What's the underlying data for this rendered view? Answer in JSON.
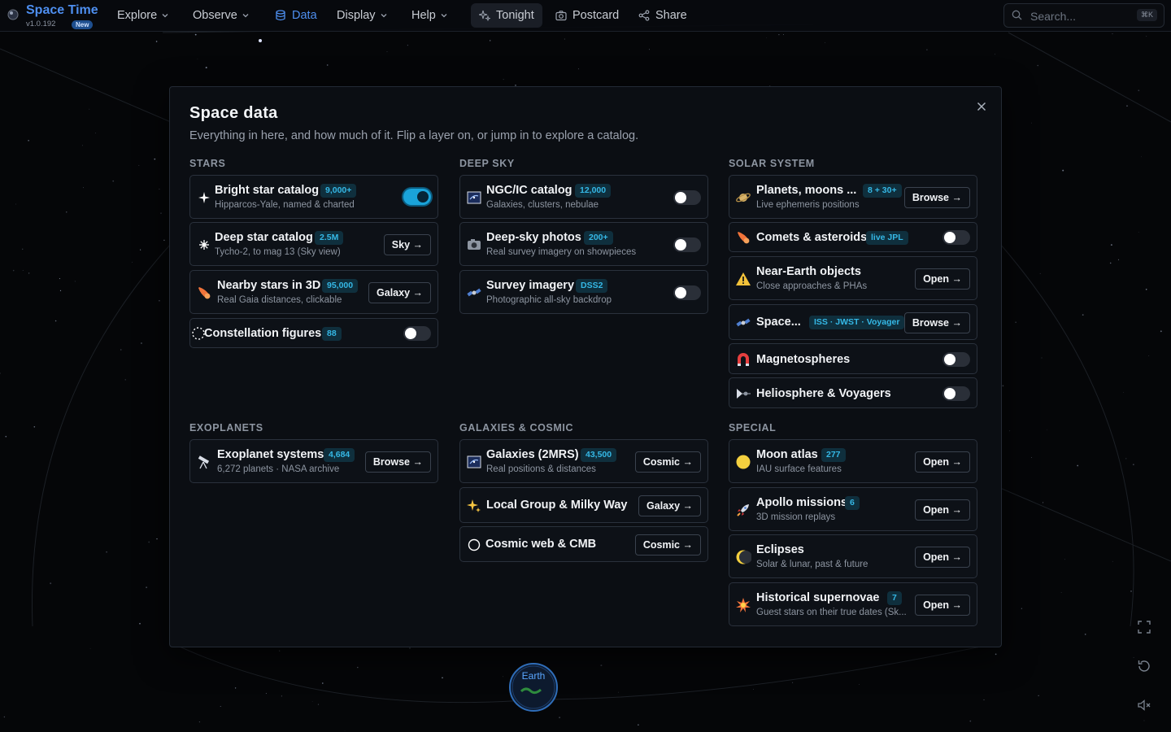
{
  "app": {
    "name": "Space Time",
    "version": "v1.0.192",
    "new_badge": "New",
    "accent": "#4e8ff0"
  },
  "nav": {
    "explore": "Explore",
    "observe": "Observe",
    "data": "Data",
    "display": "Display",
    "help": "Help",
    "tonight": "Tonight",
    "postcard": "Postcard",
    "share": "Share"
  },
  "search": {
    "placeholder": "Search...",
    "shortcut": "⌘K"
  },
  "modal": {
    "title": "Space data",
    "subtitle": "Everything in here, and how much of it. Flip a layer on, or jump in to explore a catalog."
  },
  "sections": {
    "stars": {
      "title": "STARS",
      "items": [
        {
          "icon": "sparkle-icon",
          "name": "Bright star catalog",
          "badge": "9,000+",
          "desc": "Hipparcos-Yale, named & charted",
          "toggle": true
        },
        {
          "icon": "starburst-icon",
          "name": "Deep star catalog",
          "badge": "2.5M",
          "desc": "Tycho-2, to mag 13 (Sky view)",
          "button": "Sky →"
        },
        {
          "icon": "comet-icon",
          "name": "Nearby stars in 3D",
          "badge": "95,000",
          "desc": "Real Gaia distances, clickable",
          "button": "Galaxy →"
        },
        {
          "icon": "dotted-circle-icon",
          "name": "Constellation figures",
          "badge": "88",
          "toggle": false
        }
      ]
    },
    "deep_sky": {
      "title": "DEEP SKY",
      "items": [
        {
          "icon": "galaxy-photo-icon",
          "name": "NGC/IC catalog",
          "badge": "12,000",
          "desc": "Galaxies, clusters, nebulae",
          "toggle": false
        },
        {
          "icon": "camera-icon",
          "name": "Deep-sky photos",
          "badge": "200+",
          "desc": "Real survey imagery on showpieces",
          "toggle": false
        },
        {
          "icon": "satellite-icon",
          "name": "Survey imagery",
          "badge": "DSS2",
          "desc": "Photographic all-sky backdrop",
          "toggle": false
        }
      ]
    },
    "solar_system": {
      "title": "SOLAR SYSTEM",
      "items": [
        {
          "icon": "ringed-planet-icon",
          "name": "Planets, moons ...",
          "badge": "8 + 30+",
          "desc": "Live ephemeris positions",
          "button": "Browse →"
        },
        {
          "icon": "comet-icon",
          "name": "Comets & asteroids",
          "badge": "live JPL",
          "toggle": false
        },
        {
          "icon": "warning-icon",
          "name": "Near-Earth objects",
          "desc": "Close approaches & PHAs",
          "button": "Open →"
        },
        {
          "icon": "satellite-icon",
          "name": "Space...",
          "badge": "ISS · JWST · Voyager",
          "button": "Browse →"
        },
        {
          "icon": "magnet-icon",
          "name": "Magnetospheres",
          "toggle": false
        },
        {
          "icon": "probe-icon",
          "name": "Heliosphere & Voyagers",
          "toggle": false
        }
      ]
    },
    "exoplanets": {
      "title": "EXOPLANETS",
      "items": [
        {
          "icon": "telescope-icon",
          "name": "Exoplanet systems",
          "badge": "4,684",
          "desc": "6,272 planets · NASA archive",
          "button": "Browse →"
        }
      ]
    },
    "galaxies": {
      "title": "GALAXIES & COSMIC",
      "items": [
        {
          "icon": "galaxy-photo-icon",
          "name": "Galaxies (2MRS)",
          "badge": "43,500",
          "desc": "Real positions & distances",
          "button": "Cosmic →"
        },
        {
          "icon": "sparkles-icon",
          "name": "Local Group & Milky Way",
          "button": "Galaxy →"
        },
        {
          "icon": "circle-icon",
          "name": "Cosmic web & CMB",
          "button": "Cosmic →"
        }
      ]
    },
    "special": {
      "title": "SPECIAL",
      "items": [
        {
          "icon": "moon-icon",
          "name": "Moon atlas",
          "badge": "277",
          "desc": "IAU surface features",
          "button": "Open →"
        },
        {
          "icon": "rocket-icon",
          "name": "Apollo missions",
          "badge": "6",
          "desc": "3D mission replays",
          "button": "Open →"
        },
        {
          "icon": "eclipse-icon",
          "name": "Eclipses",
          "desc": "Solar & lunar, past & future",
          "button": "Open →"
        },
        {
          "icon": "supernova-icon",
          "name": "Historical supernovae",
          "badge": "7",
          "desc": "Guest stars on their true dates (Sk...",
          "button": "Open →"
        }
      ]
    }
  },
  "scene": {
    "earth_label": "Earth"
  },
  "controls": [
    "fullscreen-icon",
    "reset-icon",
    "mute-icon"
  ]
}
